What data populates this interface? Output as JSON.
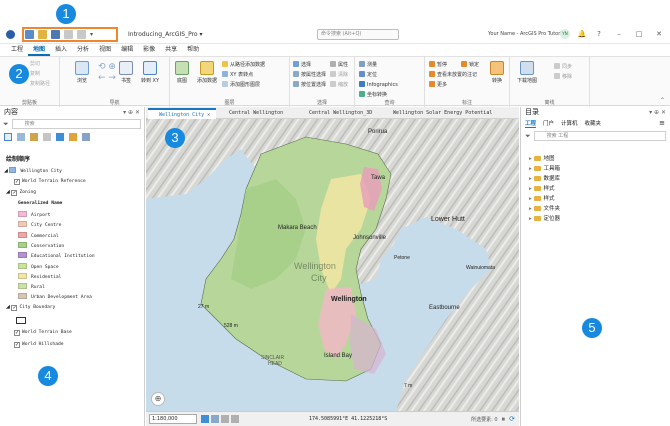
{
  "app": {
    "project_name": "Introducing_ArcGIS_Pro ▾",
    "search_placeholder": "命令搜索 (Alt+Q)",
    "user": "Your Name - ArcGIS Pro Tutorials",
    "user_initials": "YN",
    "help": "?"
  },
  "menu_tabs": [
    "工程",
    "地图",
    "插入",
    "分析",
    "视图",
    "编辑",
    "影像",
    "共享",
    "帮助"
  ],
  "ribbon": {
    "clipboard": {
      "label": "剪贴板",
      "items": [
        "粘贴",
        "剪切",
        "复制",
        "复制路径"
      ]
    },
    "navigate": {
      "label": "导航",
      "explore": "浏览",
      "bookmarks": "书签",
      "goto": "转到 XY"
    },
    "layer": {
      "label": "图层",
      "basemap": "底图",
      "add_data": "添加数据",
      "items": [
        "从路径添加数据",
        "XY 表转点",
        "添加图形图层"
      ]
    },
    "selection": {
      "label": "选择",
      "items": [
        "选择",
        "按属性选择",
        "按位置选择",
        "属性",
        "清除",
        "缩放"
      ]
    },
    "inquiry": {
      "label": "查询",
      "items": [
        "测量",
        "定位",
        "Infographics",
        "坐标转换"
      ]
    },
    "labeling": {
      "label": "标注",
      "items": [
        "暂停",
        "查看未放置的注记",
        "更多",
        "锁定"
      ],
      "convert": "转换"
    },
    "offline": {
      "label": "离线",
      "download": "下载地图",
      "items": [
        "同步",
        "移除"
      ]
    }
  },
  "contents": {
    "title": "内容",
    "search_placeholder": "搜索",
    "drawing_order": "绘制顺序",
    "map_name": "Wellington City",
    "layers": {
      "terrain_ref": "World Terrain Reference",
      "zoning": "Zoning",
      "field": "Generalized Name",
      "city_boundary": "City Boundary",
      "terrain_base": "World Terrain Base",
      "hillshade": "World Hillshade"
    },
    "legend": [
      {
        "label": "Airport",
        "color": "#f4b9d3"
      },
      {
        "label": "City Centre",
        "color": "#f2c9b7"
      },
      {
        "label": "Commercial",
        "color": "#f3a6a6"
      },
      {
        "label": "Conservation",
        "color": "#a6cf8a"
      },
      {
        "label": "Educational Institution",
        "color": "#b492d1"
      },
      {
        "label": "Open Space",
        "color": "#c8e69a"
      },
      {
        "label": "Residential",
        "color": "#f3e6a5"
      },
      {
        "label": "Rural",
        "color": "#cde0a5"
      },
      {
        "label": "Urban Development Area",
        "color": "#d8c7b5"
      }
    ]
  },
  "map_tabs": [
    "Wellington City",
    "Central Wellington",
    "Central Wellington_3D",
    "Wellington Solar Energy Potential"
  ],
  "map_labels": {
    "porirua": "Porirua",
    "tawa": "Tawa",
    "lower_hutt": "Lower Hutt",
    "makara_beach": "Makara Beach",
    "johnsonville": "Johnsonville",
    "wellington_faint": "Wellington",
    "city": "City",
    "wellington": "Wellington",
    "island_bay": "Island Bay",
    "sinclair": "SINCLAIR",
    "head": "HEAD",
    "eastbourne": "Eastbourne",
    "petone": "Petone",
    "wainuiomata": "Wainuiomata",
    "m1": "27 m",
    "m2": "528 m",
    "m3": "7 m"
  },
  "status": {
    "scale": "1:180,000",
    "coords": "174.5085991°E 41.1225218°S",
    "selected": "所选要素: 0",
    "zoom_icon_hint": "⌖"
  },
  "catalog": {
    "title": "目录",
    "tabs": [
      "工程",
      "门户",
      "计算机",
      "收藏夹"
    ],
    "search_placeholder": "搜索 工程",
    "items": [
      "地图",
      "工具箱",
      "数据库",
      "样式",
      "样式",
      "文件夹",
      "定位器"
    ]
  },
  "badges": [
    "1",
    "2",
    "3",
    "4",
    "5"
  ],
  "colors": {
    "accent": "#1a76c5",
    "badge": "#1789de",
    "water": "#c6dcea",
    "land": "#dcdcd9"
  }
}
